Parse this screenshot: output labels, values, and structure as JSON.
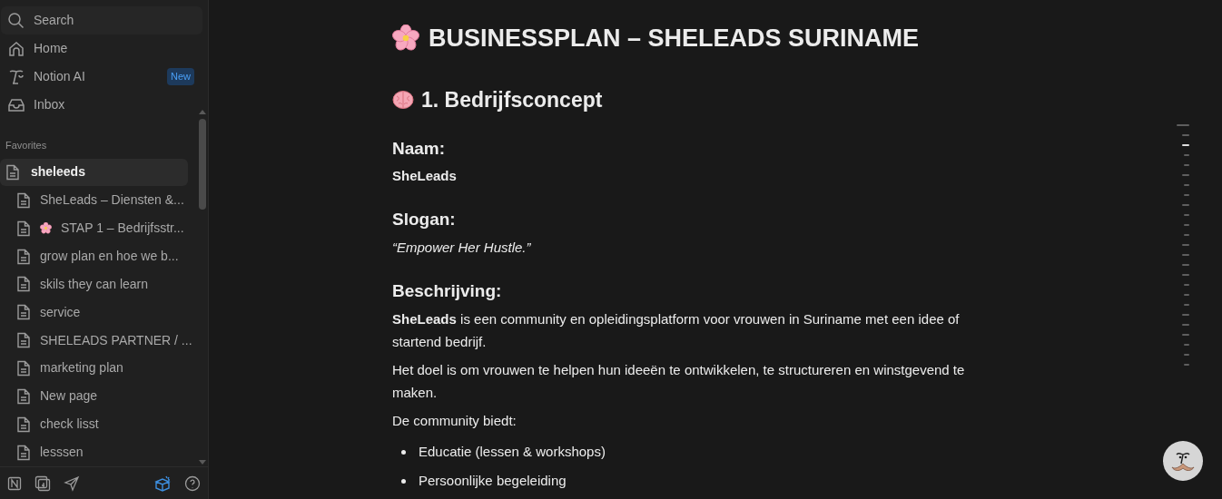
{
  "sidebar": {
    "nav": [
      {
        "kind": "search",
        "label": "Search"
      },
      {
        "kind": "home",
        "label": "Home"
      },
      {
        "kind": "ai",
        "label": "Notion AI",
        "badge": "New"
      },
      {
        "kind": "inbox",
        "label": "Inbox"
      }
    ],
    "favorites_label": "Favorites",
    "favorites": [
      {
        "label": "sheleeds",
        "selected": true,
        "children": [
          {
            "label": "SheLeads – Diensten &...",
            "kind": "page"
          },
          {
            "label": "STAP 1 – Bedrijfsstr...",
            "kind": "flower"
          },
          {
            "label": "grow plan en hoe we b...",
            "kind": "page"
          },
          {
            "label": "skils they can learn",
            "kind": "page"
          },
          {
            "label": "service",
            "kind": "page"
          },
          {
            "label": "SHELEADS PARTNER / ...",
            "kind": "page"
          },
          {
            "label": "marketing plan",
            "kind": "page"
          },
          {
            "label": "New page",
            "kind": "page"
          },
          {
            "label": "check lisst",
            "kind": "page"
          },
          {
            "label": "lesssen",
            "kind": "page"
          }
        ]
      }
    ]
  },
  "page": {
    "title": "BUSINESSPLAN – SHELEADS SURINAME",
    "section": "1. Bedrijfsconcept",
    "blocks": [
      {
        "kind": "h3",
        "text": "Naam:"
      },
      {
        "kind": "bold",
        "text": "SheLeads"
      },
      {
        "kind": "h3",
        "text": "Slogan:"
      },
      {
        "kind": "italic",
        "text": "“Empower Her Hustle.”"
      },
      {
        "kind": "h3",
        "text": "Beschrijving:"
      },
      {
        "kind": "p",
        "text": "**SheLeads** is een community en opleidingsplatform voor vrouwen in Suriname met een idee of startend bedrijf."
      },
      {
        "kind": "p",
        "text": "Het doel is om vrouwen te helpen hun ideeën te ontwikkelen, te structureren en winstgevend te maken."
      },
      {
        "kind": "p",
        "text": "De community biedt:"
      },
      {
        "kind": "bullet",
        "text": "Educatie (lessen & workshops)"
      },
      {
        "kind": "bullet",
        "text": "Persoonlijke begeleiding"
      }
    ]
  }
}
